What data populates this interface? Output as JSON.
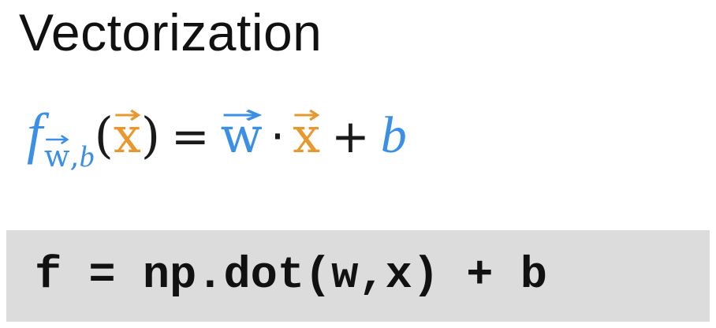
{
  "slide": {
    "title": "Vectorization",
    "equation": {
      "function_letter": "f",
      "subscript_w": "w",
      "subscript_sep": ",",
      "subscript_b": "b",
      "open_paren": "(",
      "arg_x": "x",
      "close_paren": ")",
      "equals": "=",
      "w": "w",
      "dot": "·",
      "x": "x",
      "plus": "+",
      "b": "b"
    },
    "code": "f = np.dot(w,x) + b"
  },
  "colors": {
    "blue": "#3b8fe6",
    "orange": "#e8982e",
    "code_background": "#dcdcdc"
  },
  "icons": [
    "vector-arrow-icon"
  ]
}
